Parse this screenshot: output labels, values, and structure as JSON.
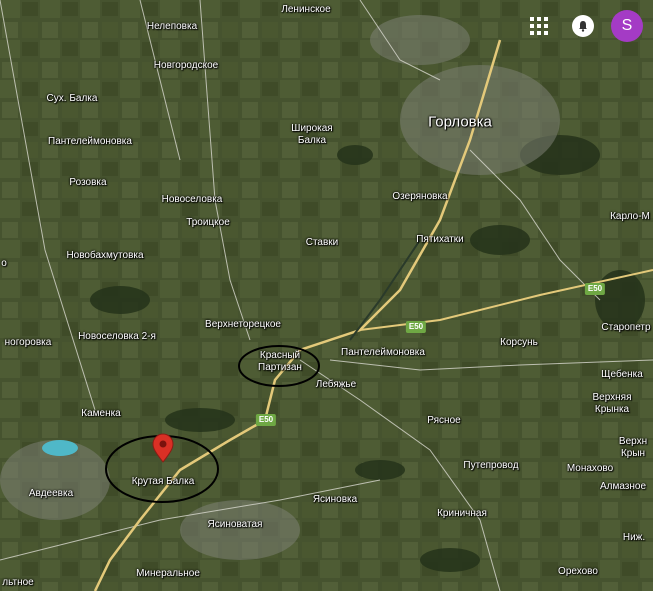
{
  "labels": {
    "lenin": "Ленинское",
    "nelepovka": "Нелеповка",
    "novgorodskoe": "Новгородское",
    "sukh_balka": "Сух. Балка",
    "panteleymonovka_w": "Пантелеймоновка",
    "rozovka": "Розовка",
    "novoselovka": "Новоселовка",
    "troitskoe": "Троицкое",
    "novobakhmutovka": "Новобахмутовка",
    "gorlovka": "Горловка",
    "shirokaya_balka": "Широкая\nБалка",
    "ozeryanovka": "Озеряновка",
    "karlo_m": "Карло-М",
    "stavki": "Ставки",
    "pyatikhatki": "Пятихатки",
    "novoselovka2": "Новоселовка 2-я",
    "ogorovka": "ногоровка",
    "verkhnetoretskoe": "Верхнеторецкое",
    "krasny_partizan": "Красный\nПартизан",
    "panteleymonovka_e": "Пантелеймоновка",
    "staropetr": "Старопетр",
    "korsun": "Корсунь",
    "lebyazhye": "Лебяжье",
    "shchebenka": "Щебенка",
    "verkhnyaya_krynka": "Верхняя\nКрынка",
    "kamenka": "Каменка",
    "ryasnoe": "Рясное",
    "verkh_krynka2": "Верхн\nКрын",
    "krutaya_balka": "Крутая Балка",
    "avdeevka": "Авдеевка",
    "truboprovod": "Путепровод",
    "monakhovo": "Монахово",
    "almaznoe": "Алмазное",
    "yasinovka": "Ясиновка",
    "yasinovataya": "Ясиноватая",
    "krinichnaya": "Криничная",
    "nizh": "Ниж.",
    "mineralnoe": "Минеральное",
    "orekhovo": "Орехово",
    "lnitnoe": "льтное",
    "short_o": "о"
  },
  "road_shields": {
    "e50_a": "E50",
    "e50_b": "E50",
    "e50_c": "E50"
  },
  "header": {
    "avatar_letter": "S"
  },
  "colors": {
    "avatar": "#a43bc5",
    "pin": "#d93025",
    "highway": "#e3c97a",
    "shield": "#6fa844"
  }
}
